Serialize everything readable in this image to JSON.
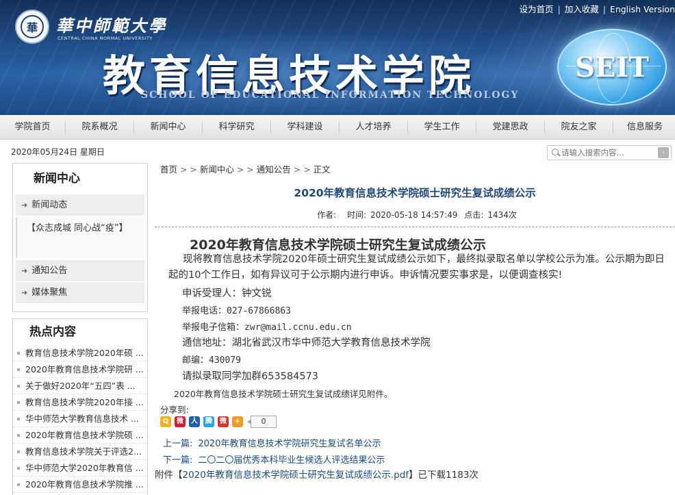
{
  "header": {
    "top_links": [
      "设为首页",
      "加入收藏",
      "English Version"
    ],
    "univ_name_cn": "華中師範大學",
    "univ_name_en": "CENTRAL CHINA NORMAL UNIVERSITY",
    "seal_char": "華",
    "school_name_cn": "教育信息技术学院",
    "school_name_en": "SCHOOL OF EDUCATIONAL INFORMATION TECHNOLOGY",
    "badge": "SEIT",
    "colors": {
      "banner": "#1e4b84",
      "link": "#1d4a7a"
    }
  },
  "nav": {
    "items": [
      "学院首页",
      "院系概况",
      "新闻中心",
      "科学研究",
      "学科建设",
      "人才培养",
      "学生工作",
      "党建思政",
      "院友之家",
      "信息服务"
    ]
  },
  "date_line": "2020年05月24日 星期日",
  "search": {
    "placeholder": "请输入搜索内容..."
  },
  "sidebar": {
    "title": "新闻中心",
    "items": [
      {
        "label": "新闻动态"
      },
      {
        "label": "【众志成城 同心战“疫”】"
      },
      {
        "label": "通知公告"
      },
      {
        "label": "媒体聚焦"
      }
    ],
    "hot_title": "热点内容",
    "hot_items": [
      "教育信息技术学院2020年硕 ...",
      "2020年教育信息技术学院研 ...",
      "关于做好2020年“五四”表 ...",
      "教育信息技术学院2020年接 ...",
      "华中师范大学教育信息技术 ...",
      "2020年教育信息技术学院硕 ...",
      "教育信息技术学院关于评选2...",
      "华中师范大学2020年教育信 ...",
      "2020年教育信息技术学院推 ..."
    ]
  },
  "breadcrumb": {
    "items": [
      "首页",
      "新闻中心",
      "通知公告",
      "正文"
    ],
    "sep": " > > "
  },
  "article": {
    "title": "2020年教育信息技术学院硕士研究生复试成绩公示",
    "author_label": "作者:",
    "time_label": "时间:",
    "time": "2020-05-18 14:57:49",
    "views_label": "点击:",
    "views": "1434次",
    "heading": "2020年教育信息技术学院硕士研究生复试成绩公示",
    "paragraph": "现将教育信息技术学院2020年硕士研究生复试成绩公示如下，最终拟录取名单以学校公示为准。公示期为即日起的10个工作日，如有异议可于公示期内进行申诉。申诉情况要实事求是，以便调查核实!",
    "contact_person": "申诉受理人：钟文锐",
    "phone": "举报电话：027-67866863",
    "email": "举报电子信箱：zwr@mail.ccnu.edu.cn",
    "address": "通信地址：湖北省武汉市华中师范大学教育信息技术学院",
    "postcode": "邮编：430079",
    "qq_group": "请拟录取同学加群653584573",
    "attach_note": "2020年教育信息技术学院硕士研究生复试成绩详见附件。",
    "share_label": "分享到:",
    "share_count": "0",
    "prev_label": "上一篇:",
    "prev_title": "2020年教育信息技术学院研究生复试名单公示",
    "next_label": "下一篇:",
    "next_title": "二〇二〇届优秀本科毕业生候选人评选结果公示",
    "attachment_prefix": "附件【",
    "attachment_name": "2020年教育信息技术学院硕士研究生复试成绩公示.pdf",
    "attachment_suffix": "】已下载1183次"
  },
  "share_icons": [
    {
      "name": "qzone-icon",
      "glyph": "Q",
      "color": "#f2b318"
    },
    {
      "name": "weibo-icon",
      "glyph": "微",
      "color": "#e6162d"
    },
    {
      "name": "renren-icon",
      "glyph": "人",
      "color": "#1d5fad"
    },
    {
      "name": "tencent-weibo-icon",
      "glyph": "腾",
      "color": "#2aa6e0"
    },
    {
      "name": "wechat-icon",
      "glyph": "微",
      "color": "#d9342c"
    },
    {
      "name": "more-share-icon",
      "glyph": "+",
      "color": "#f39b1c"
    }
  ]
}
